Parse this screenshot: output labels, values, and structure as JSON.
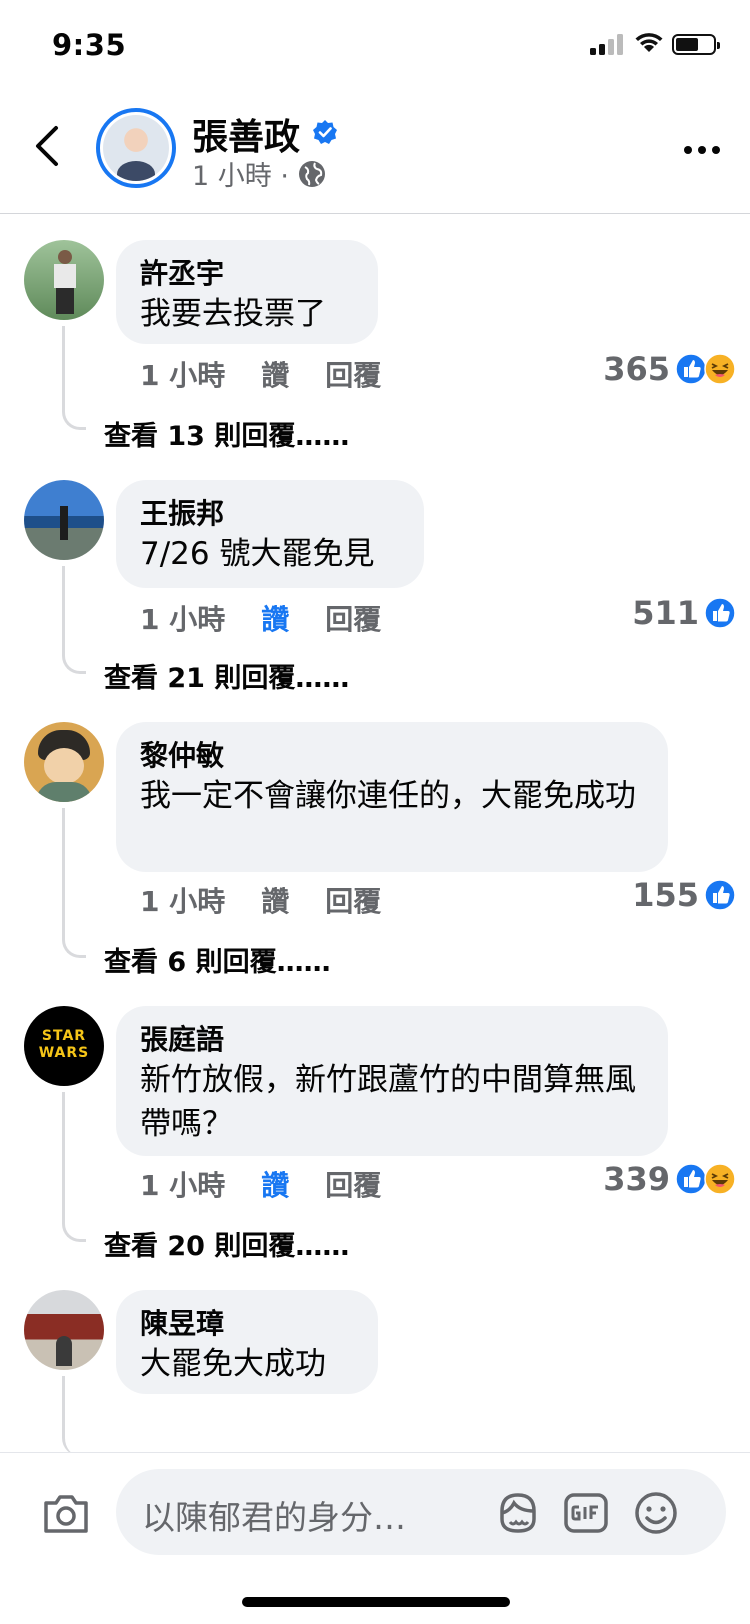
{
  "status_bar": {
    "time": "9:35"
  },
  "header": {
    "name": "張善政",
    "meta": "1 小時 ·",
    "icons": {
      "back": "chevron-left-icon",
      "verified": "verified-badge-icon",
      "audience": "globe-icon",
      "more": "more-horizontal-icon"
    }
  },
  "comments": [
    {
      "author": "許丞宇",
      "text": "我要去投票了",
      "time": "1 小時",
      "like": "讚",
      "reply": "回覆",
      "count": "365",
      "reactions": [
        "like",
        "haha"
      ],
      "liked": false,
      "view_more": "查看 13 則回覆……"
    },
    {
      "author": "王振邦",
      "text": "7/26 號大罷免見",
      "time": "1 小時",
      "like": "讚",
      "reply": "回覆",
      "count": "511",
      "reactions": [
        "like"
      ],
      "liked": true,
      "view_more": "查看 21 則回覆……"
    },
    {
      "author": "黎仲敏",
      "text": "我一定不會讓你連任的，大罷免成功",
      "time": "1 小時",
      "like": "讚",
      "reply": "回覆",
      "count": "155",
      "reactions": [
        "like"
      ],
      "liked": false,
      "view_more": "查看 6 則回覆……"
    },
    {
      "author": "張庭語",
      "text": "新竹放假，新竹跟蘆竹的中間算無風帶嗎？",
      "time": "1 小時",
      "like": "讚",
      "reply": "回覆",
      "count": "339",
      "reactions": [
        "like",
        "haha"
      ],
      "liked": true,
      "view_more": "查看 20 則回覆……",
      "avatar_text": "STAR WARS"
    },
    {
      "author": "陳昱璋",
      "text": "大罷免大成功"
    }
  ],
  "composer": {
    "placeholder": "以陳郁君的身分…",
    "icons": [
      "camera-icon",
      "avatar-sticker-icon",
      "gif-icon",
      "emoji-icon"
    ]
  },
  "colors": {
    "accent": "#1877f2",
    "bubble": "#f0f2f5",
    "muted": "#65676b"
  }
}
